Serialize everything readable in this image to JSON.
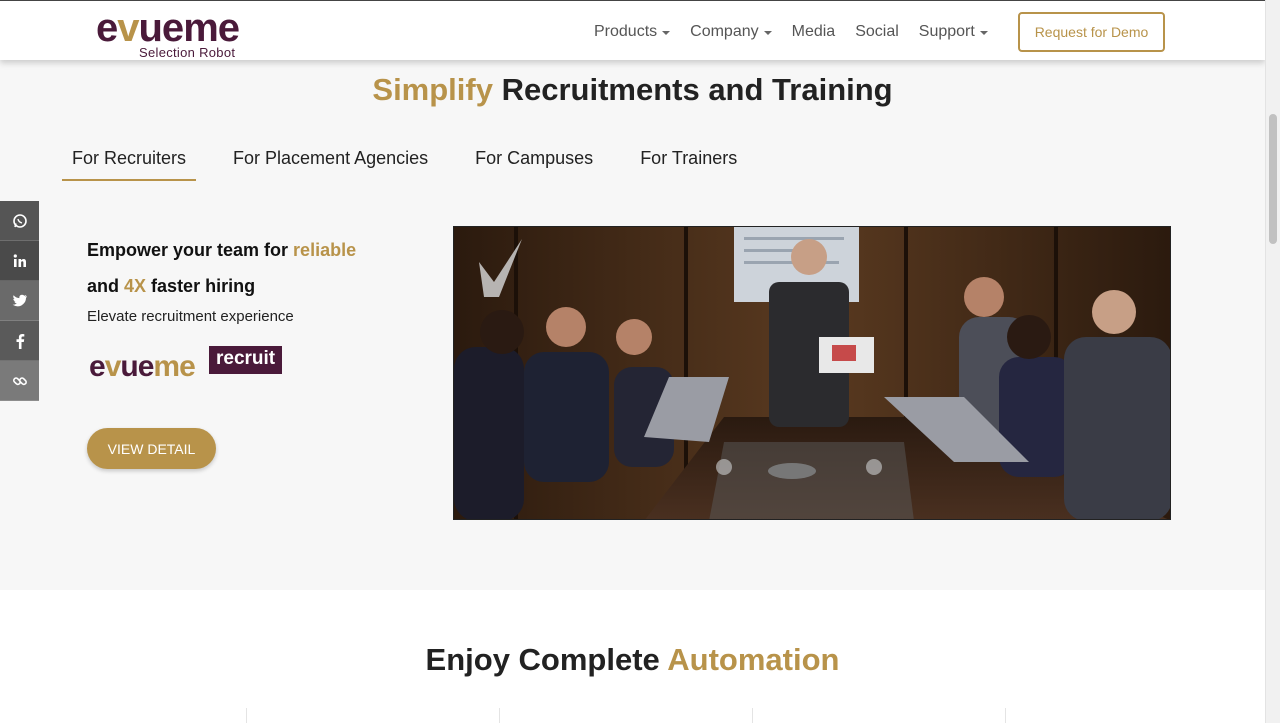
{
  "header": {
    "logo_main_a": "e",
    "logo_main_b": "v",
    "logo_main_c": "ue",
    "logo_main_d": "me",
    "logo_sub": "Selection Robot",
    "nav": [
      {
        "label": "Products",
        "dropdown": true
      },
      {
        "label": "Company",
        "dropdown": true
      },
      {
        "label": "Media",
        "dropdown": false
      },
      {
        "label": "Social",
        "dropdown": false
      },
      {
        "label": "Support",
        "dropdown": true
      }
    ],
    "demo_button": "Request for Demo"
  },
  "hero": {
    "title_gold": "Simplify",
    "title_rest": " Recruitments and Training"
  },
  "tabs": [
    {
      "label": "For Recruiters",
      "active": true
    },
    {
      "label": "For Placement Agencies",
      "active": false
    },
    {
      "label": "For Campuses",
      "active": false
    },
    {
      "label": "For Trainers",
      "active": false
    }
  ],
  "social": [
    {
      "icon": "whatsapp-icon"
    },
    {
      "icon": "linkedin-icon"
    },
    {
      "icon": "twitter-icon"
    },
    {
      "icon": "facebook-icon"
    },
    {
      "icon": "link-icon"
    }
  ],
  "panel": {
    "headline_1": "Empower your team for ",
    "headline_gold_1": "reliable",
    "headline_2": "and ",
    "headline_gold_2": "4X",
    "headline_3": " faster hiring",
    "subline": "Elevate recruitment experience",
    "product_word_a": "e",
    "product_word_b": "v",
    "product_word_c": "ue",
    "product_word_d": "me",
    "product_badge": "recruit",
    "view_button": "VIEW DETAIL"
  },
  "lower": {
    "title_rest": "Enjoy Complete ",
    "title_gold": "Automation"
  },
  "colors": {
    "gold": "#b8934a",
    "plum": "#4a1a3a"
  }
}
